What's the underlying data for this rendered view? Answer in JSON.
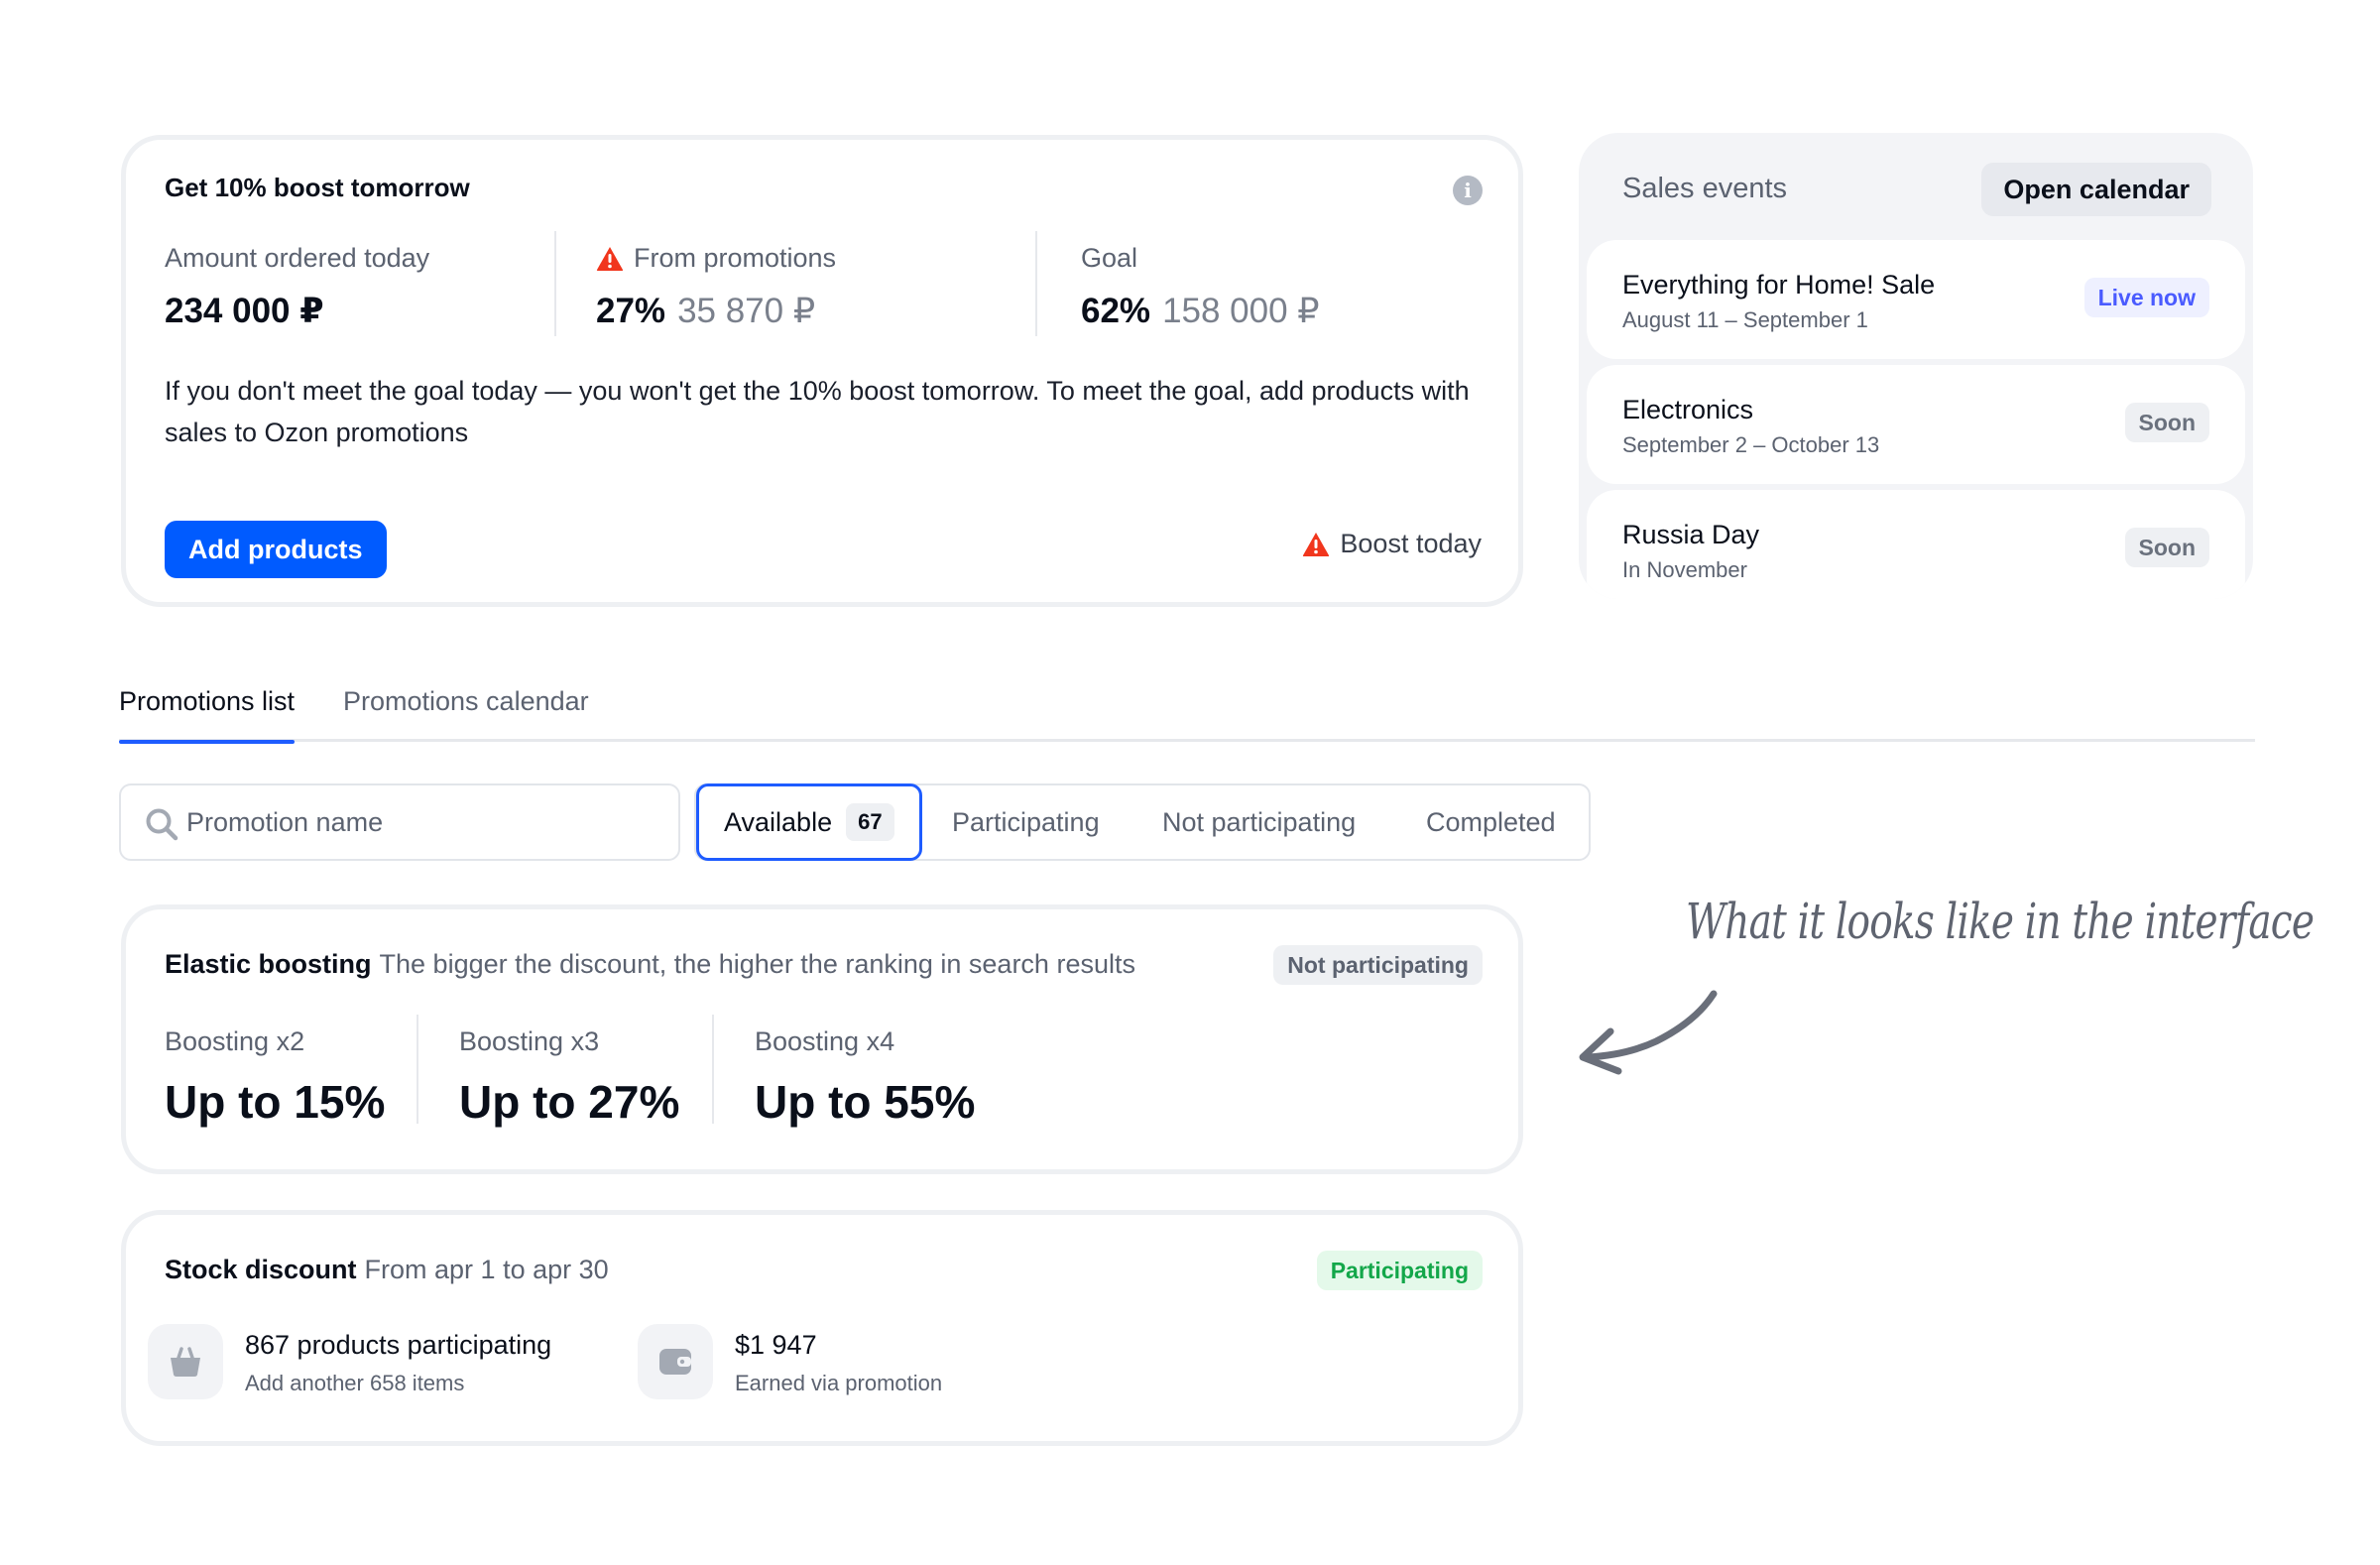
{
  "boost": {
    "title": "Get 10% boost tomorrow",
    "metrics": [
      {
        "label": "Amount ordered today",
        "value": "234 000 ₽",
        "secondary": ""
      },
      {
        "label": "From promotions",
        "value": "27%",
        "secondary": "35 870 ₽"
      },
      {
        "label": "Goal",
        "value": "62%",
        "secondary": "158 000 ₽"
      }
    ],
    "message": "If you don't meet the goal today — you won't get the 10% boost tomorrow. To meet the goal, add products with sales to Ozon promotions",
    "button_label": "Add products",
    "status_label": "Boost today"
  },
  "sales_events": {
    "title": "Sales events",
    "calendar_button": "Open calendar",
    "events": [
      {
        "name": "Everything for Home! Sale",
        "dates": "August 11 – September 1",
        "badge": "Live now"
      },
      {
        "name": "Electronics",
        "dates": "September 2 – October 13",
        "badge": "Soon"
      },
      {
        "name": "Russia Day",
        "dates": "In November",
        "badge": "Soon"
      }
    ]
  },
  "tabs": [
    {
      "label": "Promotions list",
      "active": true
    },
    {
      "label": "Promotions calendar",
      "active": false
    }
  ],
  "search": {
    "placeholder": "Promotion name"
  },
  "filters": {
    "active": {
      "label": "Available",
      "count": "67"
    },
    "others": [
      "Participating",
      "Not participating",
      "Completed"
    ]
  },
  "promotions": [
    {
      "name": "Elastic boosting",
      "description": "The bigger the discount, the higher the ranking in search results",
      "status": "Not participating",
      "levels": [
        {
          "label": "Boosting x2",
          "value": "Up to 15%"
        },
        {
          "label": "Boosting x3",
          "value": "Up to 27%"
        },
        {
          "label": "Boosting x4",
          "value": "Up to 55%"
        }
      ]
    },
    {
      "name": "Stock discount",
      "description": "From apr 1 to apr 30",
      "status": "Participating",
      "stats": [
        {
          "icon": "basket-icon",
          "main": "867 products participating",
          "sub": "Add another 658 items"
        },
        {
          "icon": "wallet-icon",
          "main": "$1 947",
          "sub": "Earned via promotion"
        }
      ]
    }
  ],
  "annotation": "What it looks like in the interface",
  "colors": {
    "primary": "#005bff",
    "active_tab": "#1e5cff",
    "warning": "#f1361d",
    "success": "#13a74a",
    "live": "#4a5bff"
  }
}
